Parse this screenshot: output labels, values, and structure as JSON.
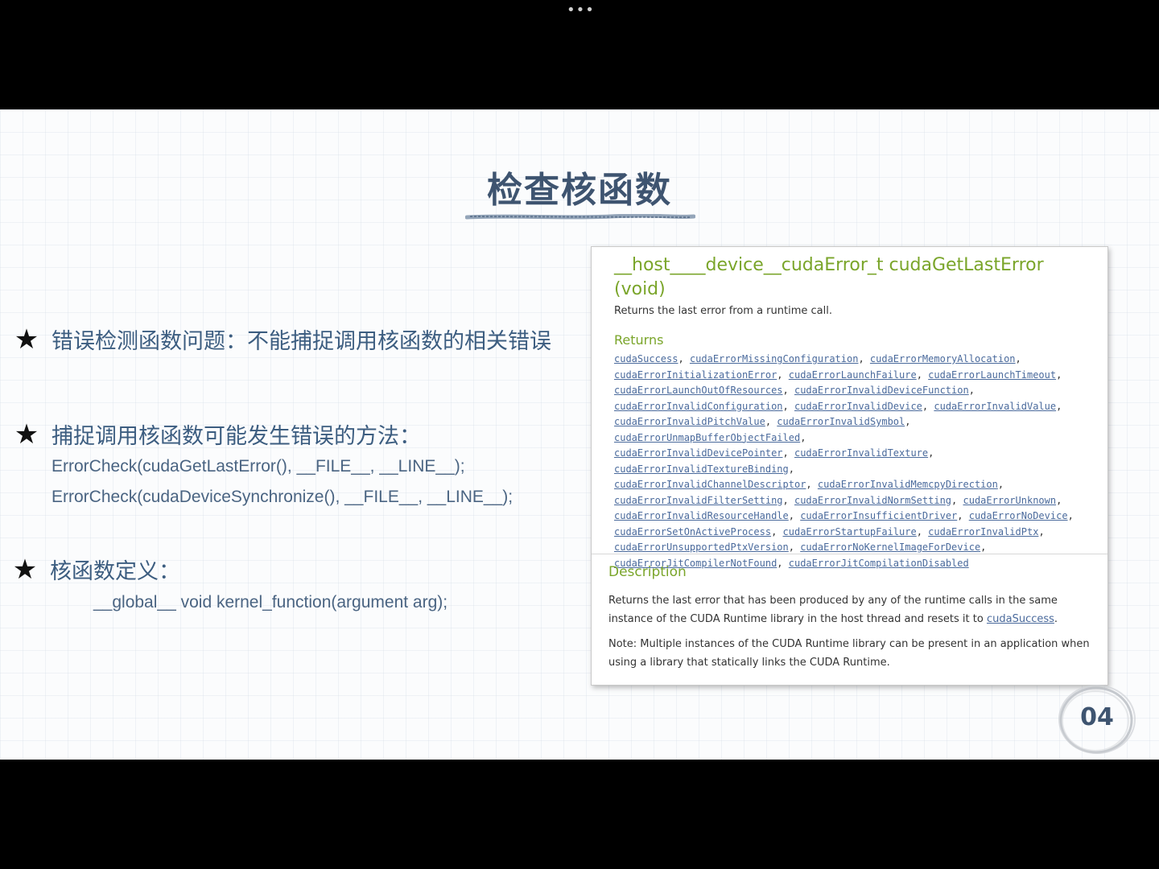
{
  "viewer": {
    "more_icon": "more-horizontal-icon",
    "more_glyph": "•••"
  },
  "slide": {
    "title": "检查核函数",
    "bullet_icon": "star-icon",
    "bullet_glyph": "★",
    "bullets": [
      {
        "text": "错误检测函数问题：不能捕捉调用核函数的相关错误"
      },
      {
        "text": "捕捉调用核函数可能发生错误的方法：",
        "code": [
          "ErrorCheck(cudaGetLastError(), __FILE__, __LINE__);",
          "ErrorCheck(cudaDeviceSynchronize(), __FILE__, __LINE__);"
        ]
      },
      {
        "text": "核函数定义：",
        "code": [
          "__global__ void kernel_function(argument arg);"
        ]
      }
    ],
    "page_number": "04"
  },
  "doc": {
    "signature": "__host____device__cudaError_t cudaGetLastError (void)",
    "brief": "Returns the last error from a runtime call.",
    "returns_heading": "Returns",
    "returns": [
      "cudaSuccess",
      "cudaErrorMissingConfiguration",
      "cudaErrorMemoryAllocation",
      "cudaErrorInitializationError",
      "cudaErrorLaunchFailure",
      "cudaErrorLaunchTimeout",
      "cudaErrorLaunchOutOfResources",
      "cudaErrorInvalidDeviceFunction",
      "cudaErrorInvalidConfiguration",
      "cudaErrorInvalidDevice",
      "cudaErrorInvalidValue",
      "cudaErrorInvalidPitchValue",
      "cudaErrorInvalidSymbol",
      "cudaErrorUnmapBufferObjectFailed",
      "cudaErrorInvalidDevicePointer",
      "cudaErrorInvalidTexture",
      "cudaErrorInvalidTextureBinding",
      "cudaErrorInvalidChannelDescriptor",
      "cudaErrorInvalidMemcpyDirection",
      "cudaErrorInvalidFilterSetting",
      "cudaErrorInvalidNormSetting",
      "cudaErrorUnknown",
      "cudaErrorInvalidResourceHandle",
      "cudaErrorInsufficientDriver",
      "cudaErrorNoDevice",
      "cudaErrorSetOnActiveProcess",
      "cudaErrorStartupFailure",
      "cudaErrorInvalidPtx",
      "cudaErrorUnsupportedPtxVersion",
      "cudaErrorNoKernelImageForDevice",
      "cudaErrorJitCompilerNotFound",
      "cudaErrorJitCompilationDisabled"
    ],
    "returns_lines": [
      [
        0,
        1,
        2
      ],
      [
        3,
        4,
        5
      ],
      [
        6,
        7
      ],
      [
        8,
        9,
        10
      ],
      [
        11,
        12,
        13
      ],
      [
        14,
        15,
        16
      ],
      [
        17,
        18
      ],
      [
        19,
        20,
        21
      ],
      [
        22,
        23,
        24
      ],
      [
        25,
        26,
        27
      ],
      [
        28,
        29
      ],
      [
        30,
        31
      ]
    ],
    "description_heading": "Description",
    "description_pre": "Returns the last error that has been produced by any of the runtime calls in the same instance of the CUDA Runtime library in the host thread and resets it to ",
    "description_link": "cudaSuccess",
    "description_post": ".",
    "note": "Note: Multiple instances of the CUDA Runtime library can be present in an application when using a library that statically links the CUDA Runtime."
  },
  "colors": {
    "title": "#3e5470",
    "bullet_text": "#3c5d80",
    "doc_green": "#7aa52a",
    "doc_link": "#4a6a9c"
  }
}
